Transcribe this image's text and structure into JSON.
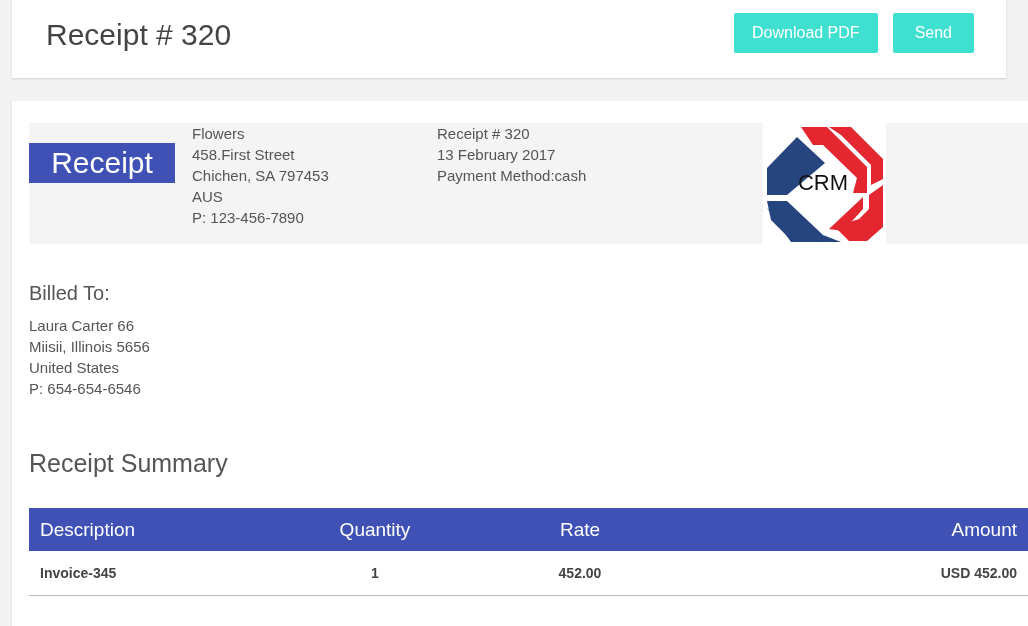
{
  "header": {
    "title": "Receipt # 320",
    "buttons": [
      "Download PDF",
      "Send"
    ]
  },
  "receipt": {
    "badge": "Receipt",
    "company": [
      "Flowers",
      "458.First Street",
      "Chichen, SA 797453",
      "AUS",
      "P: 123-456-7890"
    ],
    "details": [
      "Receipt # 320",
      "13 February 2017",
      "Payment Method:cash"
    ],
    "logo": {
      "text": "CRM"
    }
  },
  "billed_to": {
    "heading": "Billed To:",
    "lines": [
      "Laura Carter 66",
      "Miisii, Illinois 5656",
      "United States",
      "P: 654-654-6546"
    ]
  },
  "summary": {
    "heading": "Receipt Summary",
    "table": {
      "columns": [
        "Description",
        "Quantity",
        "Rate",
        "Amount"
      ],
      "rows": [
        [
          "Invoice-345",
          "1",
          "452.00",
          "USD 452.00"
        ]
      ]
    }
  }
}
